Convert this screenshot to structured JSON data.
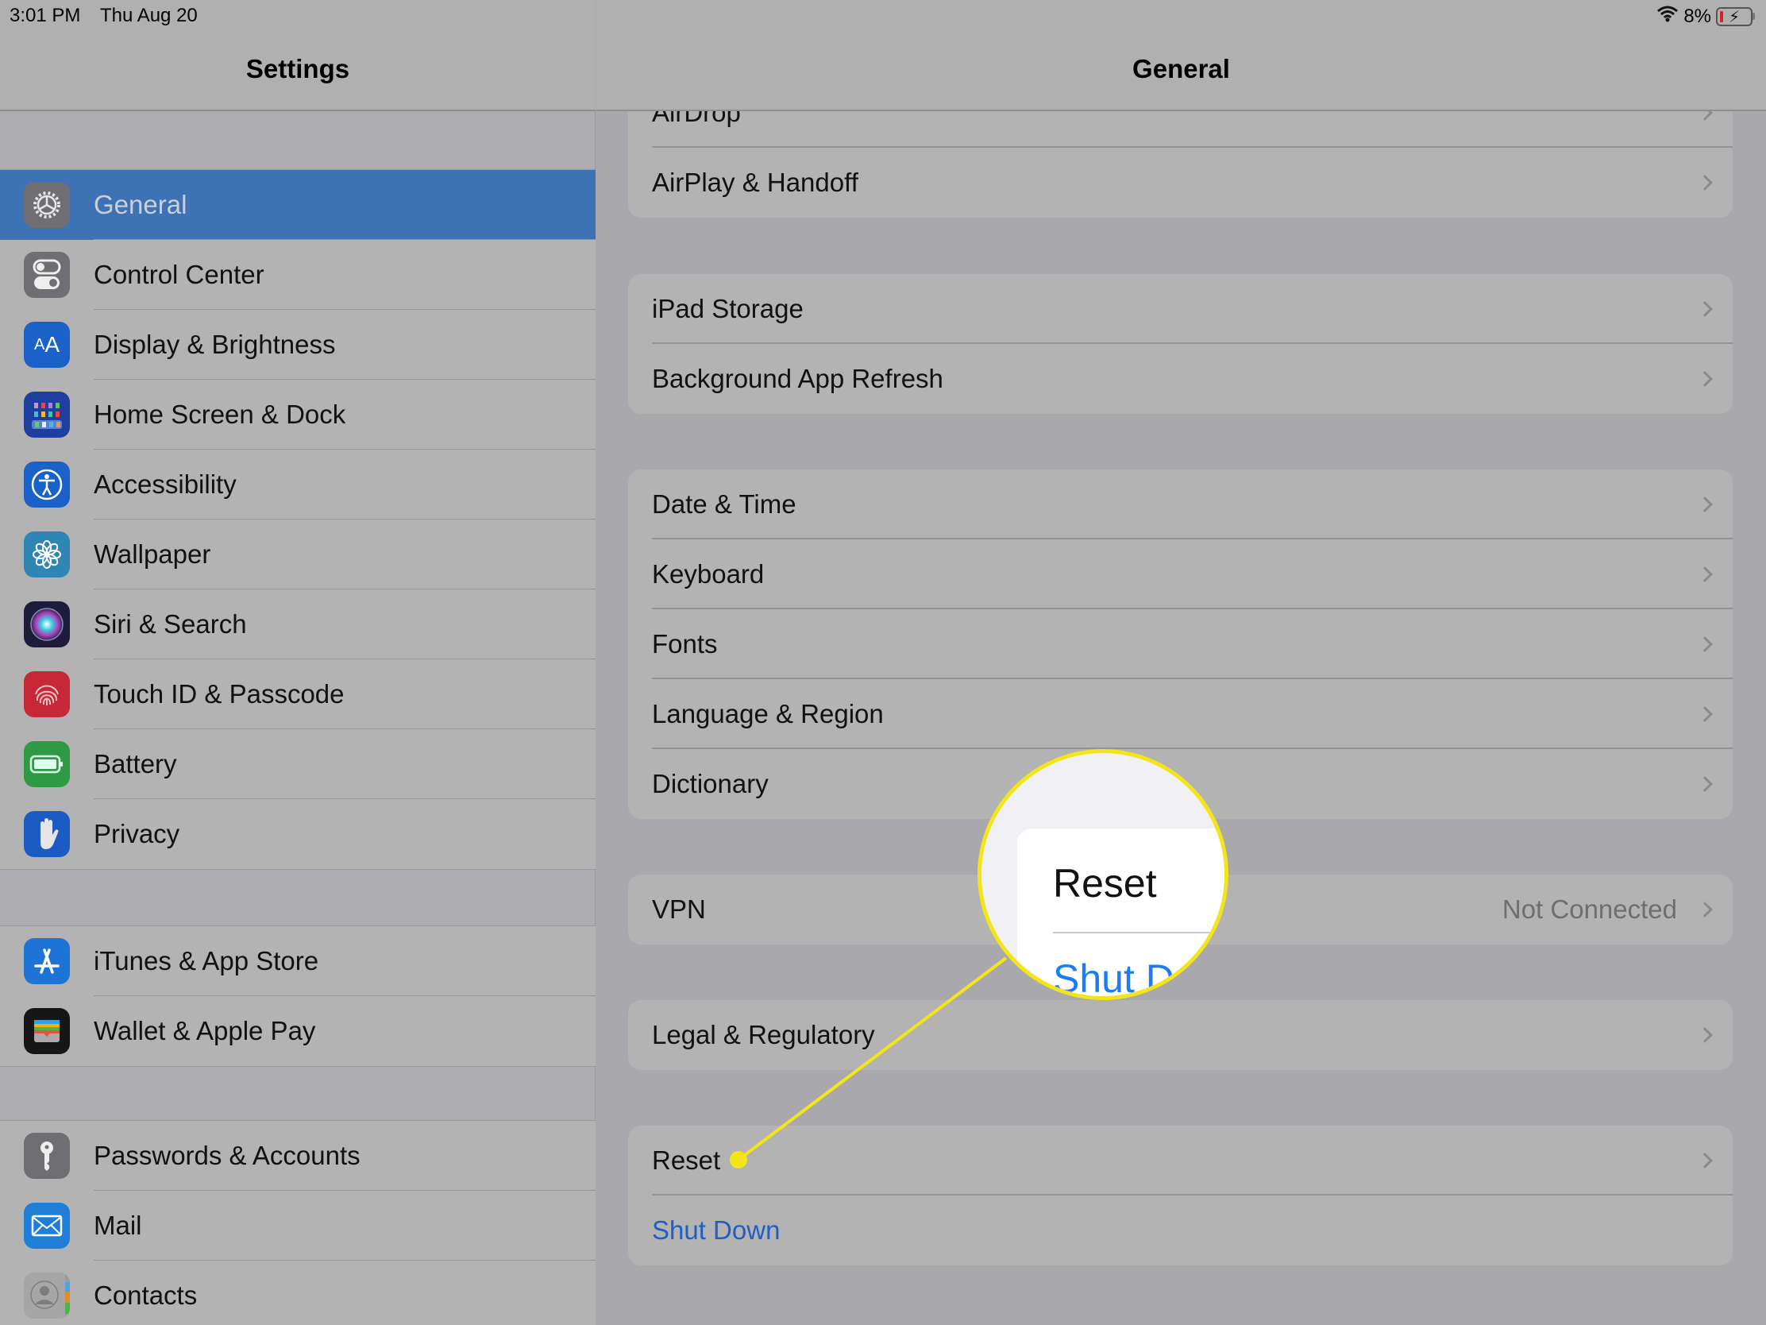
{
  "status_bar": {
    "time": "3:01 PM",
    "date": "Thu Aug 20",
    "wifi_icon": "wifi-icon",
    "battery_percent": "8%",
    "battery_level": 0.08,
    "charging": true
  },
  "sidebar": {
    "title": "Settings",
    "groups": [
      {
        "items": [
          {
            "label": "General",
            "icon": "gear-icon",
            "color": "#6f6f73",
            "selected": true
          },
          {
            "label": "Control Center",
            "icon": "toggles-icon",
            "color": "#6f6f73"
          },
          {
            "label": "Display & Brightness",
            "icon": "text-size-icon",
            "color": "#1a62c9"
          },
          {
            "label": "Home Screen & Dock",
            "icon": "app-grid-icon",
            "color": "#1f3fa0"
          },
          {
            "label": "Accessibility",
            "icon": "accessibility-icon",
            "color": "#1a62c9"
          },
          {
            "label": "Wallpaper",
            "icon": "flower-icon",
            "color": "#2f86b5"
          },
          {
            "label": "Siri & Search",
            "icon": "siri-icon",
            "color": "#1d1d3b"
          },
          {
            "label": "Touch ID & Passcode",
            "icon": "fingerprint-icon",
            "color": "#c62837"
          },
          {
            "label": "Battery",
            "icon": "battery-icon",
            "color": "#2f9a44"
          },
          {
            "label": "Privacy",
            "icon": "hand-icon",
            "color": "#1a5cc4"
          }
        ]
      },
      {
        "items": [
          {
            "label": "iTunes & App Store",
            "icon": "app-store-icon",
            "color": "#1d74d6"
          },
          {
            "label": "Wallet & Apple Pay",
            "icon": "wallet-icon",
            "color": "#161616"
          }
        ]
      },
      {
        "items": [
          {
            "label": "Passwords & Accounts",
            "icon": "key-icon",
            "color": "#6f6f73"
          },
          {
            "label": "Mail",
            "icon": "mail-icon",
            "color": "#1f7fd8"
          },
          {
            "label": "Contacts",
            "icon": "contacts-icon",
            "color": "#9a9a9a"
          }
        ]
      }
    ]
  },
  "main": {
    "title": "General",
    "groups": [
      {
        "rows": [
          {
            "label": "AirDrop"
          },
          {
            "label": "AirPlay & Handoff"
          }
        ]
      },
      {
        "rows": [
          {
            "label": "iPad Storage"
          },
          {
            "label": "Background App Refresh"
          }
        ]
      },
      {
        "rows": [
          {
            "label": "Date & Time"
          },
          {
            "label": "Keyboard"
          },
          {
            "label": "Fonts"
          },
          {
            "label": "Language & Region"
          },
          {
            "label": "Dictionary"
          }
        ]
      },
      {
        "rows": [
          {
            "label": "VPN",
            "value": "Not Connected"
          }
        ]
      },
      {
        "rows": [
          {
            "label": "Legal & Regulatory"
          }
        ]
      },
      {
        "rows": [
          {
            "label": "Reset"
          },
          {
            "label": "Shut Down",
            "action": true
          }
        ]
      }
    ]
  },
  "callout": {
    "highlight_color": "#f4e51a",
    "magnified_label_1": "Reset",
    "magnified_label_2": "Shut D",
    "target": "Reset"
  },
  "colors": {
    "selection": "#3d72b4",
    "link_blue": "#1f5fc4"
  }
}
